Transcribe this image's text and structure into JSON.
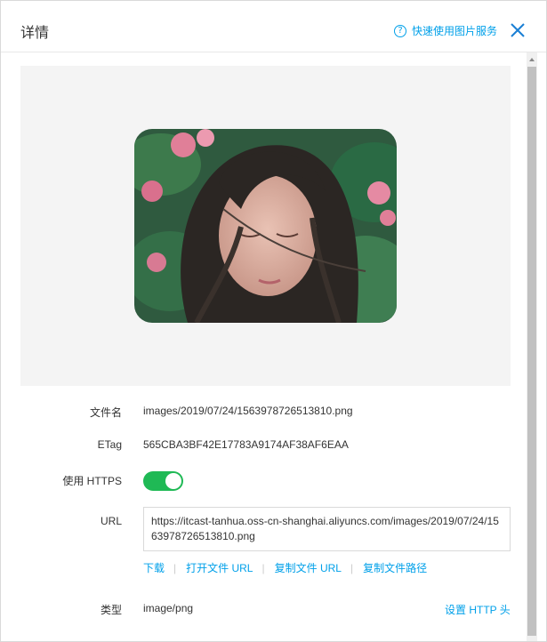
{
  "header": {
    "title": "详情",
    "quick_link": "快速使用图片服务",
    "help_glyph": "?",
    "close_icon": "close-icon"
  },
  "preview": {
    "image_icon": "portrait-photo",
    "accent_color": "#00a0e9"
  },
  "details": {
    "filename": {
      "label": "文件名",
      "value": "images/2019/07/24/1563978726513810.png"
    },
    "etag": {
      "label": "ETag",
      "value": "565CBA3BF42E17783A9174AF38AF6EAA"
    },
    "https": {
      "label": "使用 HTTPS",
      "enabled": true,
      "color": "#1fb955"
    },
    "url": {
      "label": "URL",
      "value": "https://itcast-tanhua.oss-cn-shanghai.aliyuncs.com/images/2019/07/24/1563978726513810.png"
    },
    "actions": {
      "download": "下载",
      "open_url": "打开文件 URL",
      "copy_url": "复制文件 URL",
      "copy_path": "复制文件路径"
    },
    "type": {
      "label": "类型",
      "value": "image/png",
      "set_http": "设置 HTTP 头"
    }
  }
}
